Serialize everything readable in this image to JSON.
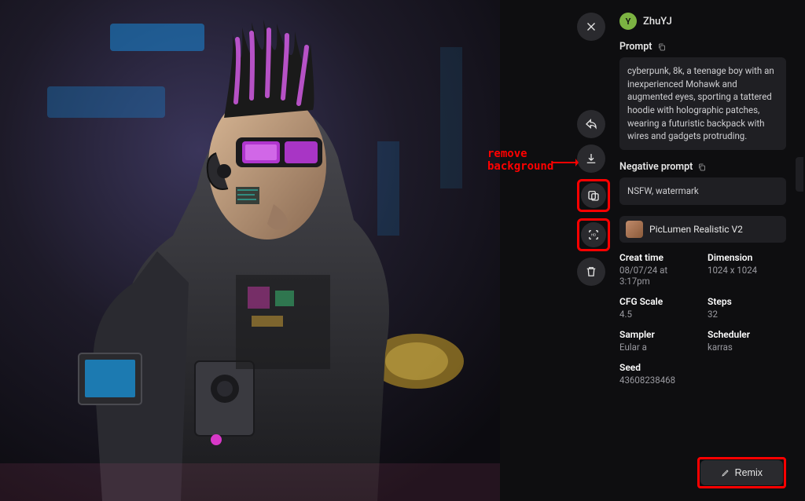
{
  "user": {
    "avatar_letter": "Y",
    "name": "ZhuYJ"
  },
  "sections": {
    "prompt_label": "Prompt",
    "prompt_text": "cyberpunk, 8k, a teenage boy with an inexperienced Mohawk and augmented eyes, sporting a tattered hoodie with holographic patches, wearing a futuristic backpack with wires and gadgets protruding.",
    "negative_label": "Negative prompt",
    "negative_text": "NSFW, watermark"
  },
  "model": {
    "name": "PicLumen Realistic V2"
  },
  "meta": {
    "create_time": {
      "label": "Creat time",
      "value": "08/07/24 at 3:17pm"
    },
    "dimension": {
      "label": "Dimension",
      "value": "1024 x 1024"
    },
    "cfg_scale": {
      "label": "CFG Scale",
      "value": "4.5"
    },
    "steps": {
      "label": "Steps",
      "value": "32"
    },
    "sampler": {
      "label": "Sampler",
      "value": "Eular a"
    },
    "scheduler": {
      "label": "Scheduler",
      "value": "karras"
    },
    "seed": {
      "label": "Seed",
      "value": "43608238468"
    }
  },
  "remix_label": "Remix",
  "annotation": "remove\nbackground"
}
